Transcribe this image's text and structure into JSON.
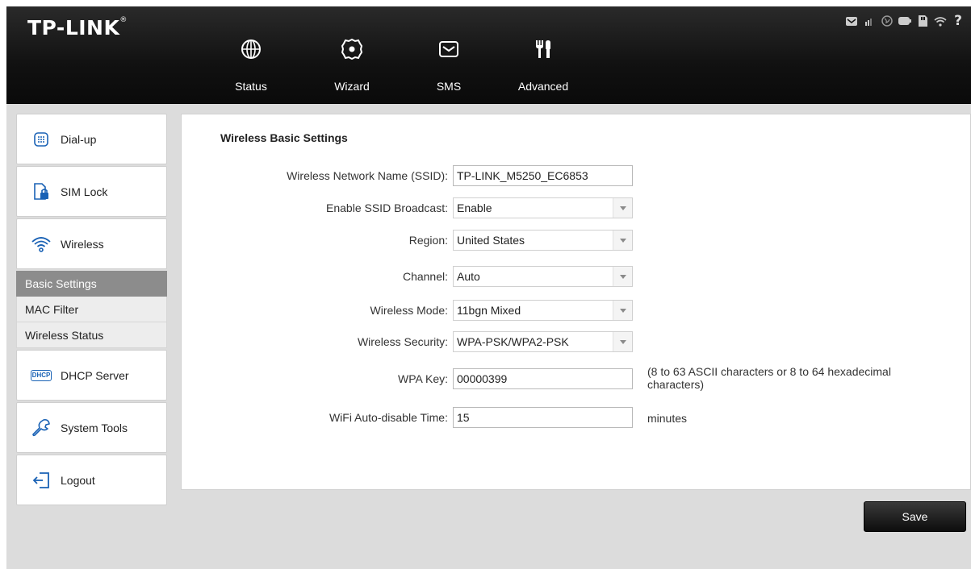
{
  "header": {
    "logo_text": "TP-LINK",
    "logo_mark": "®",
    "nav": [
      {
        "label": "Status",
        "icon": "globe-icon"
      },
      {
        "label": "Wizard",
        "icon": "wizard-gear-icon"
      },
      {
        "label": "SMS",
        "icon": "envelope-icon"
      },
      {
        "label": "Advanced",
        "icon": "advanced-tools-icon"
      }
    ],
    "status_icons": [
      "sms-status-icon",
      "signal-icon",
      "internet-icon",
      "battery-icon",
      "sim-card-icon",
      "wifi-icon",
      "help-icon"
    ]
  },
  "sidebar": {
    "items": [
      {
        "label": "Dial-up",
        "icon": "dialpad-icon"
      },
      {
        "label": "SIM Lock",
        "icon": "sim-lock-icon"
      },
      {
        "label": "Wireless",
        "icon": "wireless-icon"
      },
      {
        "label": "DHCP Server",
        "icon": "dhcp-icon"
      },
      {
        "label": "System Tools",
        "icon": "wrench-icon"
      },
      {
        "label": "Logout",
        "icon": "logout-icon"
      }
    ],
    "wireless_sub": [
      {
        "label": "Basic Settings",
        "active": true
      },
      {
        "label": "MAC Filter",
        "active": false
      },
      {
        "label": "Wireless Status",
        "active": false
      }
    ],
    "dhcp_icon_text": "DHCP"
  },
  "main": {
    "title": "Wireless Basic Settings",
    "ssid": {
      "label": "Wireless Network Name (SSID):",
      "value": "TP-LINK_M5250_EC6853"
    },
    "ssid_broadcast": {
      "label": "Enable SSID Broadcast:",
      "value": "Enable"
    },
    "region": {
      "label": "Region:",
      "value": "United States"
    },
    "channel": {
      "label": "Channel:",
      "value": "Auto"
    },
    "mode": {
      "label": "Wireless Mode:",
      "value": "11bgn Mixed"
    },
    "security": {
      "label": "Wireless Security:",
      "value": "WPA-PSK/WPA2-PSK"
    },
    "wpa_key": {
      "label": "WPA Key:",
      "value": "00000399",
      "hint_line1": "(8 to 63 ASCII characters or 8 to 64 hexadecimal",
      "hint_line2": "characters)"
    },
    "auto_disable": {
      "label": "WiFi Auto-disable Time:",
      "value": "15",
      "unit": "minutes"
    }
  },
  "footer": {
    "save_label": "Save"
  }
}
